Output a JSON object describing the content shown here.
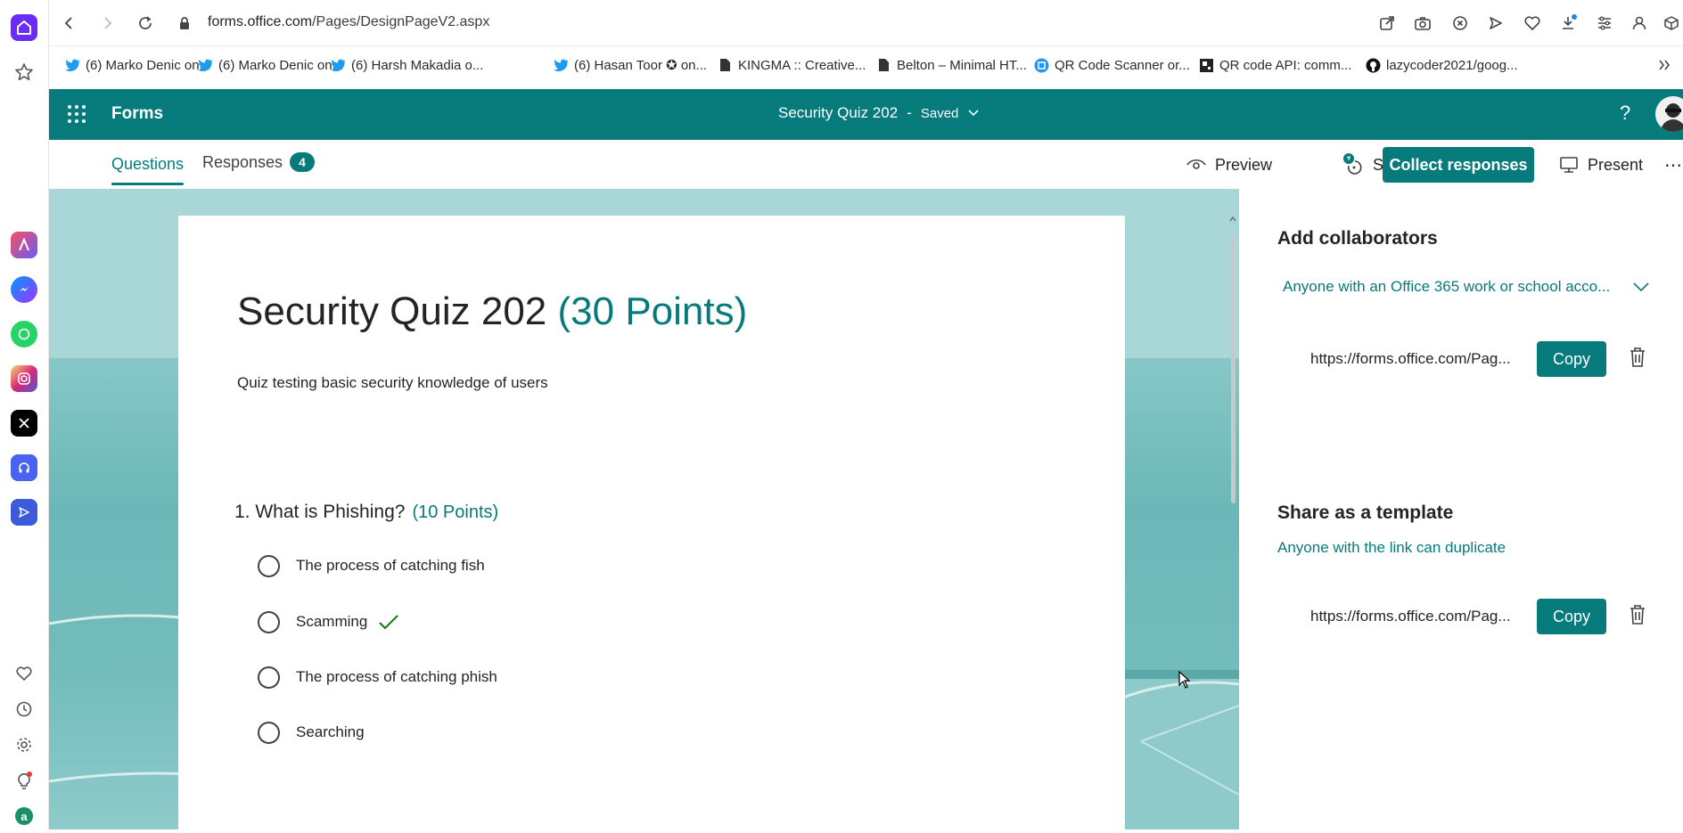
{
  "browser": {
    "url_host": "forms.office.com",
    "url_path": "/Pages/DesignPageV2.aspx"
  },
  "bookmarks": [
    {
      "label": "(6) Marko Denic on...",
      "icon": "twitter-icon"
    },
    {
      "label": "(6) Marko Denic on...",
      "icon": "twitter-icon"
    },
    {
      "label": "(6) Harsh Makadia o...",
      "icon": "twitter-icon"
    },
    {
      "label": "(6) Hasan Toor ✪ on...",
      "icon": "twitter-icon"
    },
    {
      "label": "KINGMA :: Creative...",
      "icon": "page-icon"
    },
    {
      "label": "Belton – Minimal HT...",
      "icon": "page-icon"
    },
    {
      "label": "QR Code Scanner or...",
      "icon": "qr-icon"
    },
    {
      "label": "QR code API: comm...",
      "icon": "qr-icon"
    },
    {
      "label": "lazycoder2021/goog...",
      "icon": "github-icon"
    }
  ],
  "header": {
    "app_name": "Forms",
    "form_title": "Security Quiz 202",
    "separator": "-",
    "status": "Saved",
    "help": "?"
  },
  "tabs": {
    "questions": "Questions",
    "responses": "Responses",
    "responses_count": "4"
  },
  "toolbar": {
    "preview": "Preview",
    "style": "Style",
    "collect": "Collect responses",
    "present": "Present",
    "more": "⋯"
  },
  "form": {
    "title": "Security Quiz 202",
    "title_points": "(30 Points)",
    "description": "Quiz testing basic security knowledge of users",
    "question": {
      "number": "1.",
      "text": "What is Phishing?",
      "points": "(10 Points)",
      "options": [
        {
          "label": "The process of catching fish",
          "correct": false
        },
        {
          "label": "Scamming",
          "correct": true
        },
        {
          "label": "The process of catching phish",
          "correct": false
        },
        {
          "label": "Searching",
          "correct": false
        }
      ]
    }
  },
  "share": {
    "collab_heading": "Add collaborators",
    "collab_scope": "Anyone with an Office 365 work or school acco...",
    "collab_link": "https://forms.office.com/Pag...",
    "copy_label": "Copy",
    "template_heading": "Share as a template",
    "template_scope": "Anyone with the link can duplicate",
    "template_link": "https://forms.office.com/Pag..."
  },
  "colors": {
    "accent": "#077a7c",
    "canvas": "#6bb7b7"
  }
}
